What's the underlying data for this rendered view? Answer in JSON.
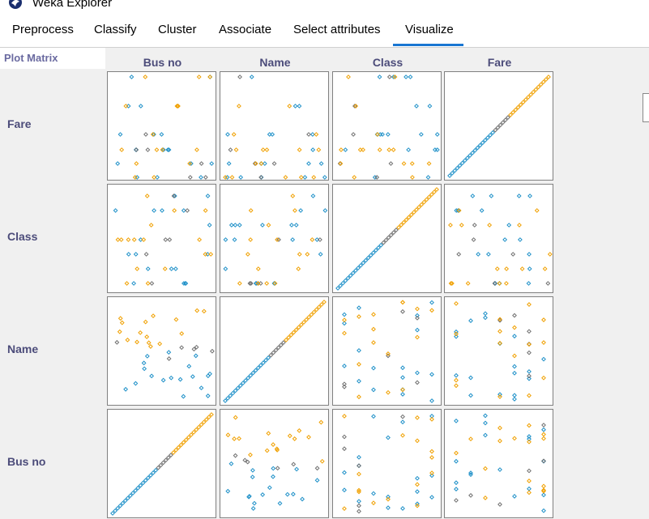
{
  "window": {
    "title": "Weka Explorer"
  },
  "tabs": [
    {
      "label": "Preprocess"
    },
    {
      "label": "Classify"
    },
    {
      "label": "Cluster"
    },
    {
      "label": "Associate"
    },
    {
      "label": "Select attributes"
    },
    {
      "label": "Visualize"
    }
  ],
  "active_tab": "Visualize",
  "plot_matrix": {
    "label": "Plot Matrix",
    "columns": [
      "Bus no",
      "Name",
      "Class",
      "Fare"
    ],
    "rows": [
      "Fare",
      "Class",
      "Name",
      "Bus no"
    ],
    "colors": {
      "low": "#1e90c8",
      "high": "#f0a000",
      "mid": "#707070"
    }
  }
}
